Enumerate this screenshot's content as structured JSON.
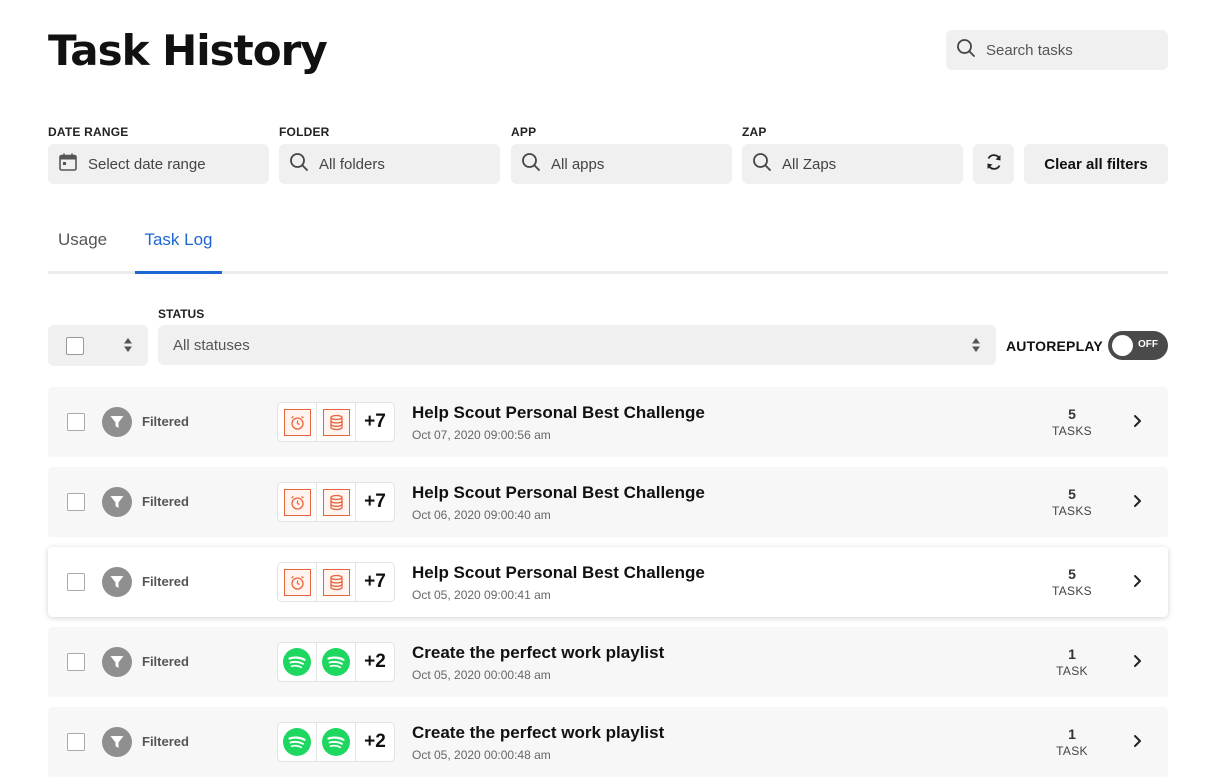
{
  "header": {
    "title": "Task History"
  },
  "search": {
    "placeholder": "Search tasks"
  },
  "filters": {
    "date_range": {
      "label": "DATE RANGE",
      "placeholder": "Select date range"
    },
    "folder": {
      "label": "FOLDER",
      "value": "All folders"
    },
    "app": {
      "label": "APP",
      "value": "All apps"
    },
    "zap": {
      "label": "ZAP",
      "value": "All Zaps"
    },
    "clear_label": "Clear all filters"
  },
  "tabs": [
    {
      "label": "Usage",
      "active": false
    },
    {
      "label": "Task Log",
      "active": true
    }
  ],
  "controls": {
    "status_label": "STATUS",
    "status_value": "All statuses",
    "autoreplay_label": "AUTOREPLAY",
    "autoreplay_state": "OFF"
  },
  "rows": [
    {
      "status": "Filtered",
      "apps": [
        "schedule-icon",
        "storage-icon"
      ],
      "more": "+7",
      "name": "Help Scout Personal Best Challenge",
      "date": "Oct 07, 2020 09:00:56 am",
      "task_count": "5",
      "task_unit": "TASKS"
    },
    {
      "status": "Filtered",
      "apps": [
        "schedule-icon",
        "storage-icon"
      ],
      "more": "+7",
      "name": "Help Scout Personal Best Challenge",
      "date": "Oct 06, 2020 09:00:40 am",
      "task_count": "5",
      "task_unit": "TASKS"
    },
    {
      "status": "Filtered",
      "apps": [
        "schedule-icon",
        "storage-icon"
      ],
      "more": "+7",
      "name": "Help Scout Personal Best Challenge",
      "date": "Oct 05, 2020 09:00:41 am",
      "task_count": "5",
      "task_unit": "TASKS"
    },
    {
      "status": "Filtered",
      "apps": [
        "spotify-icon",
        "spotify-icon"
      ],
      "more": "+2",
      "name": "Create the perfect work playlist",
      "date": "Oct 05, 2020 00:00:48 am",
      "task_count": "1",
      "task_unit": "TASK"
    },
    {
      "status": "Filtered",
      "apps": [
        "spotify-icon",
        "spotify-icon"
      ],
      "more": "+2",
      "name": "Create the perfect work playlist",
      "date": "Oct 05, 2020 00:00:48 am",
      "task_count": "1",
      "task_unit": "TASK"
    }
  ],
  "colors": {
    "accent": "#1e66d4",
    "app_orange": "#e8643c",
    "spotify_green": "#1ed760",
    "filter_gray": "#8f8f8f"
  }
}
